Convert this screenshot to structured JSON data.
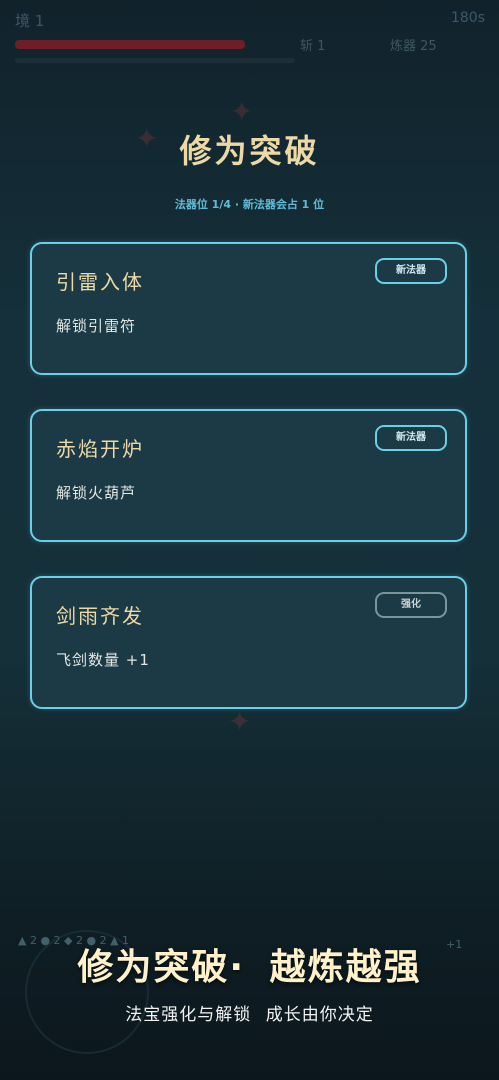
{
  "hud": {
    "realm": "境 1",
    "timer": "180s",
    "kills": "斩 1",
    "forge": "炼器 25",
    "hp_fraction": 0.82
  },
  "screen": {
    "title": "修为突破",
    "subtitle": "法器位 1/4 · 新法器会占 1 位"
  },
  "cards": [
    {
      "name": "引雷入体",
      "desc": "解锁引雷符",
      "tag": "新法器"
    },
    {
      "name": "赤焰开炉",
      "desc": "解锁火葫芦",
      "tag": "新法器"
    },
    {
      "name": "剑雨齐发",
      "desc": "飞剑数量 +1",
      "tag": "强化"
    }
  ],
  "bottom_hints": {
    "left": "▲ 2  ● 2  ◆ 2  ● 2  ▲ 1",
    "right": "+1"
  },
  "banner": {
    "main": "修为突破· 越炼越强",
    "sub": "法宝强化与解锁 成长由你决定"
  },
  "colors": {
    "accent_border": "#6ad0ea",
    "title_gold": "#ecd9a6",
    "hp_red": "#6e1f25"
  }
}
